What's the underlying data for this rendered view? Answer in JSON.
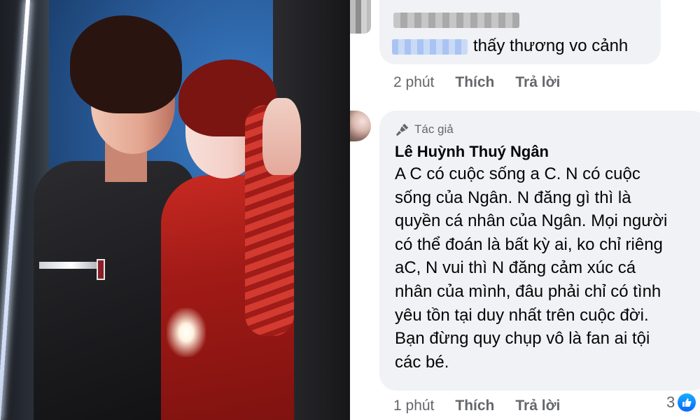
{
  "photo": {
    "alt": ""
  },
  "comment1": {
    "text": "thấy thương vo cảnh",
    "time": "2 phút",
    "like_label": "Thích",
    "reply_label": "Trả lời"
  },
  "comment2": {
    "author_badge": "Tác giả",
    "author_name": "Lê Huỳnh Thuý Ngân",
    "lines": [
      "A C có cuộc sống a C. N có cuộc",
      "sống của Ngân. N đăng gì thì là",
      "quyền cá nhân của Ngân. Mọi người",
      "có thể đoán là bất kỳ ai, ko chỉ riêng",
      "aC, N vui thì N đăng cảm xúc cá",
      "nhân của mình, đâu phải chỉ có tình",
      "yêu tồn tại duy nhất trên cuộc đời.",
      "Bạn đừng quy chụp vô là fan ai tội",
      "các bé."
    ],
    "time": "1 phút",
    "like_label": "Thích",
    "reply_label": "Trả lời",
    "reaction_count": "3",
    "reaction_icon": "like-icon"
  },
  "colors": {
    "bubble_bg": "#f0f2f5",
    "meta_text": "#65676b",
    "main_text": "#050505",
    "like_blue": "#0866ff"
  }
}
